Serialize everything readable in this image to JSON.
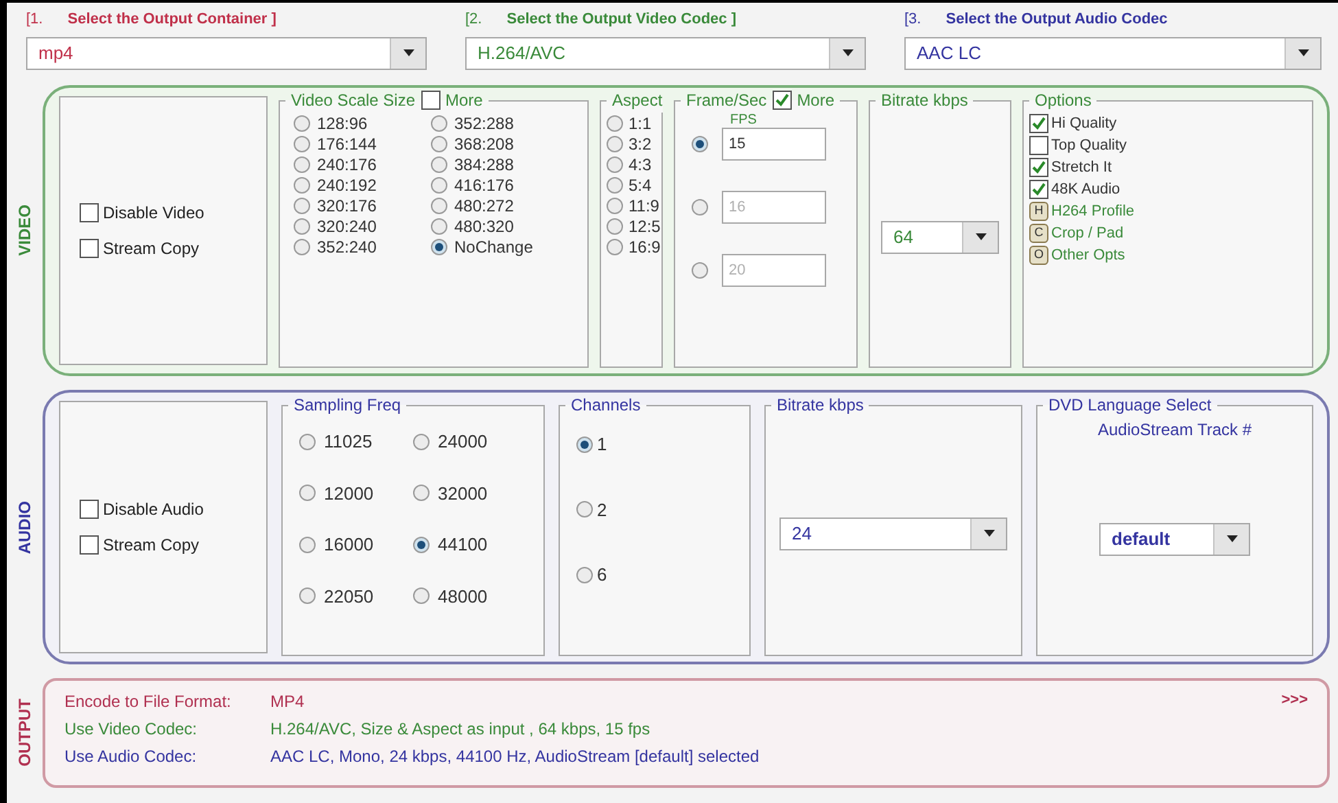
{
  "selectors": [
    {
      "number": "[1.",
      "title": "Select the Output Container ]",
      "value": "mp4",
      "color": "#c0304a"
    },
    {
      "number": "[2.",
      "title": "Select the Output Video Codec ]",
      "value": "H.264/AVC",
      "color": "#3a8a3a"
    },
    {
      "number": "[3.",
      "title": "Select the Output Audio Codec",
      "value": "AAC LC",
      "color": "#3434a0"
    }
  ],
  "video": {
    "section_label": "VIDEO",
    "toggles": [
      {
        "label": "Disable Video",
        "checked": false
      },
      {
        "label": "Stream Copy",
        "checked": false
      }
    ],
    "scale_size": {
      "title": "Video Scale Size",
      "more": {
        "label": "More",
        "checked": false
      },
      "options": [
        {
          "label": "128:96",
          "selected": false
        },
        {
          "label": "176:144",
          "selected": false
        },
        {
          "label": "240:176",
          "selected": false
        },
        {
          "label": "240:192",
          "selected": false
        },
        {
          "label": "320:176",
          "selected": false
        },
        {
          "label": "320:240",
          "selected": false
        },
        {
          "label": "352:240",
          "selected": false
        },
        {
          "label": "352:288",
          "selected": false
        },
        {
          "label": "368:208",
          "selected": false
        },
        {
          "label": "384:288",
          "selected": false
        },
        {
          "label": "416:176",
          "selected": false
        },
        {
          "label": "480:272",
          "selected": false
        },
        {
          "label": "480:320",
          "selected": false
        },
        {
          "label": "NoChange",
          "selected": true
        }
      ]
    },
    "aspect": {
      "title": "Aspect",
      "options": [
        {
          "label": "1:1",
          "selected": false
        },
        {
          "label": "3:2",
          "selected": false
        },
        {
          "label": "4:3",
          "selected": false
        },
        {
          "label": "5:4",
          "selected": false
        },
        {
          "label": "11:9",
          "selected": false
        },
        {
          "label": "12:5",
          "selected": false
        },
        {
          "label": "16:9",
          "selected": false
        }
      ]
    },
    "frame_rate": {
      "title": "Frame/Sec",
      "more": {
        "label": "More",
        "checked": true
      },
      "fps_label": "FPS",
      "options": [
        {
          "value": "15",
          "selected": true,
          "disabled": false
        },
        {
          "value": "16",
          "selected": false,
          "disabled": true
        },
        {
          "value": "20",
          "selected": false,
          "disabled": true
        }
      ]
    },
    "bitrate": {
      "title": "Bitrate  kbps",
      "value": "64"
    },
    "options": {
      "title": "Options",
      "items": [
        {
          "kind": "checkbox",
          "label": "Hi Quality",
          "checked": true
        },
        {
          "kind": "checkbox",
          "label": "Top Quality",
          "checked": false
        },
        {
          "kind": "checkbox",
          "label": "Stretch It",
          "checked": true
        },
        {
          "kind": "checkbox",
          "label": "48K Audio",
          "checked": true
        },
        {
          "kind": "button",
          "key": "H",
          "label": "H264 Profile"
        },
        {
          "kind": "button",
          "key": "C",
          "label": "Crop / Pad"
        },
        {
          "kind": "button",
          "key": "O",
          "label": "Other Opts"
        }
      ]
    }
  },
  "audio": {
    "section_label": "AUDIO",
    "toggles": [
      {
        "label": "Disable Audio",
        "checked": false
      },
      {
        "label": "Stream Copy",
        "checked": false
      }
    ],
    "sampling": {
      "title": "Sampling Freq",
      "options": [
        {
          "label": "11025",
          "selected": false
        },
        {
          "label": "24000",
          "selected": false
        },
        {
          "label": "12000",
          "selected": false
        },
        {
          "label": "32000",
          "selected": false
        },
        {
          "label": "16000",
          "selected": false
        },
        {
          "label": "44100",
          "selected": true
        },
        {
          "label": "22050",
          "selected": false
        },
        {
          "label": "48000",
          "selected": false
        }
      ]
    },
    "channels": {
      "title": "Channels",
      "options": [
        {
          "label": "1",
          "selected": true
        },
        {
          "label": "2",
          "selected": false
        },
        {
          "label": "6",
          "selected": false
        }
      ]
    },
    "bitrate": {
      "title": "Bitrate  kbps",
      "value": "24"
    },
    "language": {
      "title": "DVD Language Select",
      "subtitle": "AudioStream  Track #",
      "value": "default"
    }
  },
  "output": {
    "section_label": "OUTPUT",
    "more": ">>>",
    "rows": [
      {
        "label": "Encode to File Format:",
        "value": "MP4",
        "color": "#b03050"
      },
      {
        "label": "Use Video Codec:",
        "value": "H.264/AVC,  Size & Aspect as input ,  64 kbps,  15 fps",
        "color": "#3a8a3a"
      },
      {
        "label": "Use Audio Codec:",
        "value": "AAC LC,  Mono,  24 kbps,  44100 Hz,  AudioStream [default] selected",
        "color": "#3434a0"
      }
    ]
  }
}
